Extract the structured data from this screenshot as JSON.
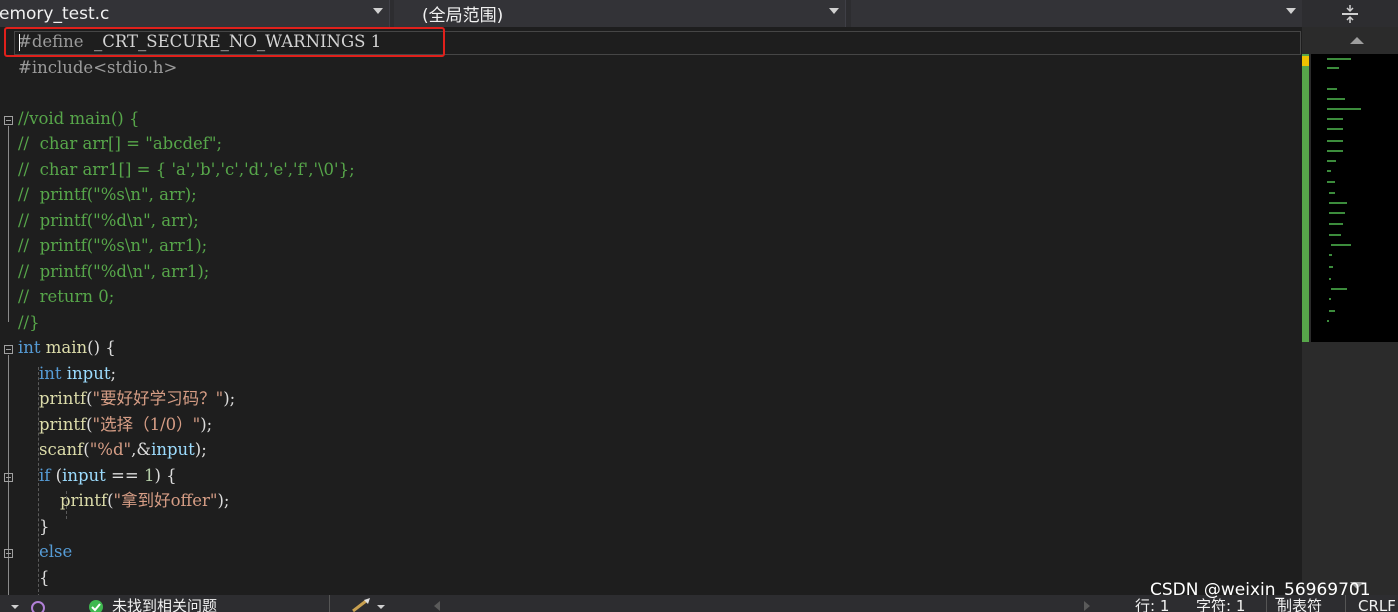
{
  "navbar": {
    "file_dropdown": "emory_test.c",
    "scope_dropdown": "(全局范围)",
    "member_dropdown": ""
  },
  "editor": {
    "lines": [
      [
        [
          "c-pre",
          "#define  "
        ],
        [
          "c-mac",
          "_CRT_SECURE_NO_WARNINGS 1"
        ]
      ],
      [
        [
          "c-pre",
          "#include<stdio.h>"
        ]
      ],
      [],
      [
        [
          "c-com",
          "//void main() {"
        ]
      ],
      [
        [
          "c-com",
          "//  char arr[] = \"abcdef\";"
        ]
      ],
      [
        [
          "c-com",
          "//  char arr1[] = { 'a','b','c','d','e','f','\\0'};"
        ]
      ],
      [
        [
          "c-com",
          "//  printf(\"%s\\n\", arr);"
        ]
      ],
      [
        [
          "c-com",
          "//  printf(\"%d\\n\", arr);"
        ]
      ],
      [
        [
          "c-com",
          "//  printf(\"%s\\n\", arr1);"
        ]
      ],
      [
        [
          "c-com",
          "//  printf(\"%d\\n\", arr1);"
        ]
      ],
      [
        [
          "c-com",
          "//  return 0;"
        ]
      ],
      [
        [
          "c-com",
          "//}"
        ]
      ],
      [
        [
          "c-kw",
          "int "
        ],
        [
          "c-fn",
          "main"
        ],
        [
          "c-pl",
          "() {"
        ]
      ],
      [
        [
          "c-pl",
          "    "
        ],
        [
          "c-kw",
          "int "
        ],
        [
          "c-id",
          "input"
        ],
        [
          "c-pl",
          ";"
        ]
      ],
      [
        [
          "c-pl",
          "    "
        ],
        [
          "c-fn",
          "printf"
        ],
        [
          "c-pl",
          "("
        ],
        [
          "c-str",
          "\"要好好学习码？\""
        ],
        [
          "c-pl",
          ");"
        ]
      ],
      [
        [
          "c-pl",
          "    "
        ],
        [
          "c-fn",
          "printf"
        ],
        [
          "c-pl",
          "("
        ],
        [
          "c-str",
          "\"选择（1/0）\""
        ],
        [
          "c-pl",
          ");"
        ]
      ],
      [
        [
          "c-pl",
          "    "
        ],
        [
          "c-fn",
          "scanf"
        ],
        [
          "c-pl",
          "("
        ],
        [
          "c-str",
          "\"%d\""
        ],
        [
          "c-pl",
          ",&"
        ],
        [
          "c-id",
          "input"
        ],
        [
          "c-pl",
          ");"
        ]
      ],
      [
        [
          "c-pl",
          "    "
        ],
        [
          "c-kw",
          "if "
        ],
        [
          "c-pl",
          "("
        ],
        [
          "c-id",
          "input"
        ],
        [
          "c-pl",
          " == "
        ],
        [
          "c-num",
          "1"
        ],
        [
          "c-pl",
          ") {"
        ]
      ],
      [
        [
          "c-pl",
          "        "
        ],
        [
          "c-fn",
          "printf"
        ],
        [
          "c-pl",
          "("
        ],
        [
          "c-str",
          "\"拿到好offer\""
        ],
        [
          "c-pl",
          ");"
        ]
      ],
      [
        [
          "c-pl",
          "    }"
        ]
      ],
      [
        [
          "c-pl",
          "    "
        ],
        [
          "c-kw",
          "else"
        ]
      ],
      [
        [
          "c-pl",
          "    {"
        ]
      ]
    ]
  },
  "statusbar": {
    "no_issues": "未找到相关问题",
    "row": "行: 1",
    "col": "字符: 1",
    "tabs": "制表符",
    "eol": "CRLF"
  },
  "watermark": "CSDN @weixin_56969701",
  "colors": {
    "highlight_box": "#e0201b",
    "keyword": "#569cd6",
    "comment": "#57a64a",
    "string": "#d69d85",
    "status_ok": "#3fb950"
  }
}
